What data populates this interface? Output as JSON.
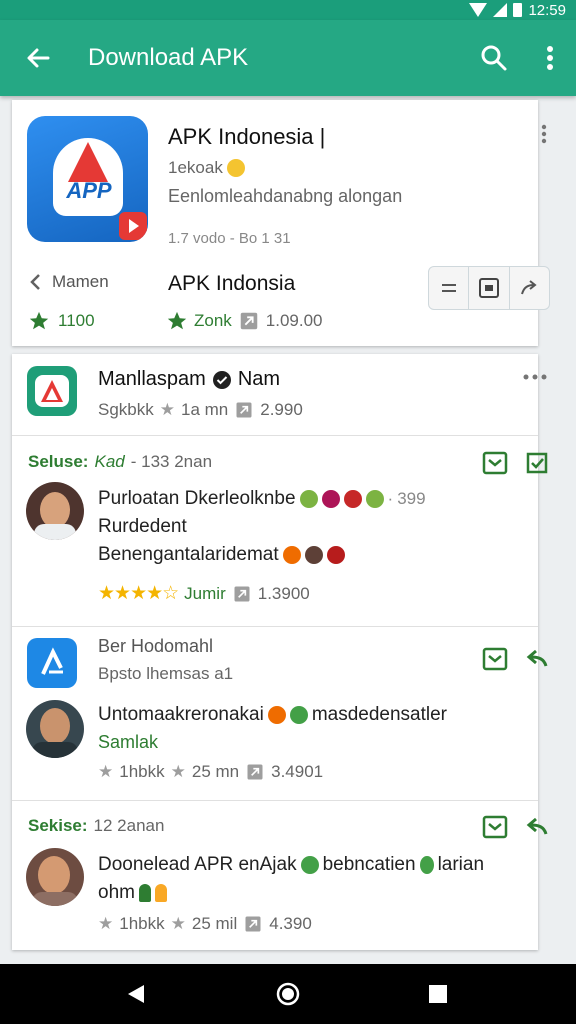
{
  "status_bar": {
    "time": "12:59",
    "icons": [
      "wifi-icon",
      "signal-icon",
      "battery-icon"
    ]
  },
  "app_bar": {
    "title": "Download APK",
    "icons": [
      "arrow-back-icon",
      "search-icon",
      "more-vert-icon"
    ]
  },
  "featured": {
    "icon_text": "APP",
    "title": "APK Indonesia |",
    "developer": "1ekoak",
    "subtitle": "Eenlomleahdanabng alongan",
    "meta": "1.7 vodo - Bo 1 31",
    "back_label": "Mamen",
    "app_name": "APK Indonsia",
    "rating_left": "1100",
    "rating_right_label": "Zonk",
    "downloads": "1.09.00"
  },
  "list": {
    "header": {
      "title": "Manllaspam",
      "title_suffix": "Nam",
      "meta_prefix": "Sgkbkk",
      "meta_time": "1a mn",
      "meta_count": "2.990"
    },
    "items": [
      {
        "label_prefix": "Seluse:",
        "label_name": "Kad",
        "label_suffix": "- 133 2nan",
        "line1": "Purloatan Dkerleolknbe",
        "line1_suffix": "399",
        "line2": "Rurdedent",
        "line3": "Benengantalaridemat",
        "rating_label": "Jumir",
        "count": "1.3900"
      },
      {
        "title": "Ber Hodomahl",
        "subtitle": "Bpsto lhemsas a1",
        "line1": "Untomaakreronakai",
        "line1_suffix": "masdedensatler",
        "line2": "Samlak",
        "meta_prefix": "1hbkk",
        "meta_time": "25 mn",
        "count": "3.4901"
      },
      {
        "label_prefix": "Sekise:",
        "label_suffix": "12 2anan",
        "line1": "Doonelead APR enAjak",
        "line1_mid": "bebncatien",
        "line1_suffix": "larian",
        "line2": "ohm",
        "meta_prefix": "1hbkk",
        "meta_time": "25 mil",
        "count": "4.390"
      }
    ]
  },
  "colors": {
    "primary": "#25a884",
    "primary_dark": "#1b9e7b",
    "accent_green": "#2e7d32",
    "star": "#f4b400"
  },
  "nav_bar": {
    "icons": [
      "back-triangle-icon",
      "home-circle-icon",
      "recents-square-icon"
    ]
  }
}
